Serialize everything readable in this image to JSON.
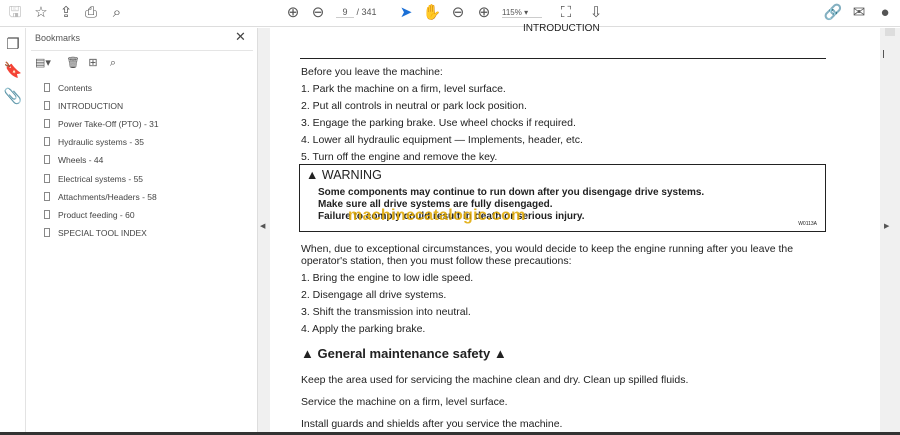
{
  "toolbar": {
    "page_current": "9",
    "page_total": "/ 341",
    "zoom": "115%"
  },
  "bookmarks": {
    "title": "Bookmarks",
    "items": [
      "Contents",
      "INTRODUCTION",
      "Power Take-Off (PTO) - 31",
      "Hydraulic systems - 35",
      "Wheels - 44",
      "Electrical systems - 55",
      "Attachments/Headers - 58",
      "Product feeding - 60",
      "SPECIAL TOOL INDEX"
    ]
  },
  "doc": {
    "header": "INTRODUCTION",
    "intro": "Before you leave the machine:",
    "steps": [
      "1.  Park the machine on a firm, level surface.",
      "2.  Put all controls in neutral or park lock position.",
      "3.  Engage the parking brake.  Use wheel chocks if required.",
      "4.  Lower all hydraulic equipment — Implements, header, etc.",
      "5.  Turn off the engine and remove the key."
    ],
    "warning": {
      "title": "WARNING",
      "lines": [
        "Some components may continue to run down after you disengage drive systems.",
        "Make sure all drive systems are fully disengaged.",
        "Failure to comply could result in death or serious injury."
      ],
      "code": "W0113A"
    },
    "watermark": "machinecatalogic.com",
    "para1a": "When, due to exceptional circumstances, you would decide to keep the engine running after you leave the",
    "para1b": "operator's station, then you must follow these precautions:",
    "steps2": [
      "1.  Bring the engine to low idle speed.",
      "2.  Disengage all drive systems.",
      "3.  Shift the transmission into neutral.",
      "4.  Apply the parking brake."
    ],
    "section": "General maintenance safety",
    "p2": "Keep the area used for servicing the machine clean and dry.  Clean up spilled fluids.",
    "p3": "Service the machine on a firm, level surface.",
    "p4": "Install guards and shields after you service the machine."
  }
}
